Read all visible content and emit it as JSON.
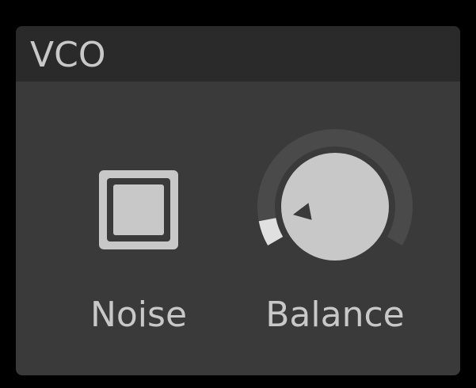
{
  "module": {
    "title": "VCO"
  },
  "controls": {
    "noise": {
      "label": "Noise",
      "icon": "square-toggle-icon"
    },
    "balance": {
      "label": "Balance",
      "value": 0.08,
      "icon": "rotary-knob-icon"
    }
  },
  "colors": {
    "background": "#000000",
    "panel": "#3a3a3a",
    "header": "#2a2a2a",
    "foreground": "#c8c8c8",
    "knob_track": "#4a4a4a",
    "knob_fill": "#e0e0e0"
  }
}
